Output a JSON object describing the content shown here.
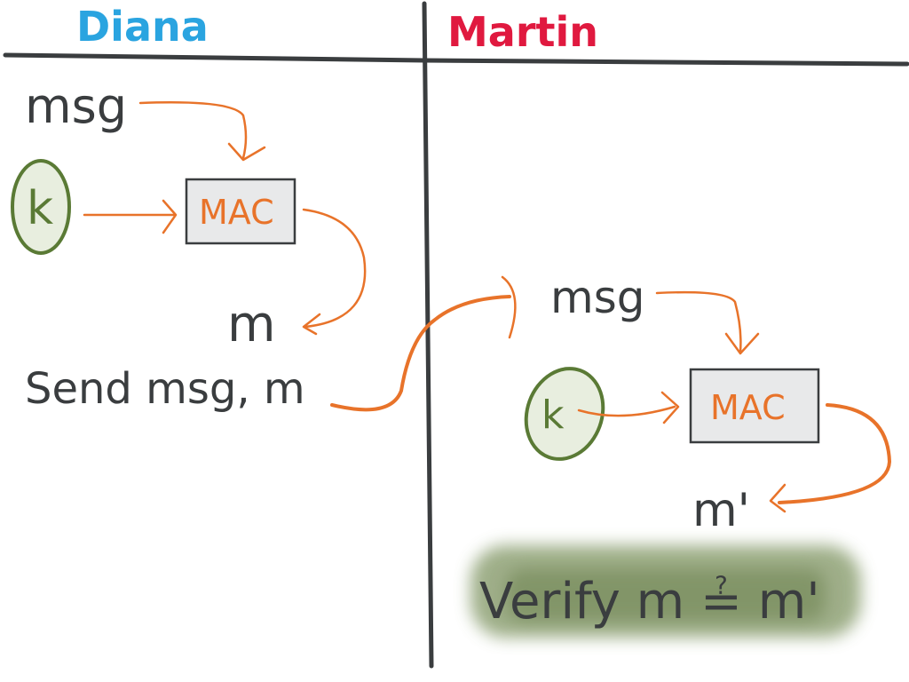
{
  "columns": {
    "left_title": "Diana",
    "right_title": "Martin"
  },
  "left": {
    "msg": "msg",
    "key": "k",
    "mac": "MAC",
    "output": "m",
    "send": "Send msg, m"
  },
  "right": {
    "msg": "msg",
    "key": "k",
    "mac": "MAC",
    "output": "m'",
    "verify": "Verify m ≟ m'"
  },
  "colors": {
    "diana": "#2aa4e0",
    "martin": "#e0193f",
    "arrow": "#e8732a",
    "key": "#5a7a35",
    "highlight": "#8a9a6e"
  }
}
